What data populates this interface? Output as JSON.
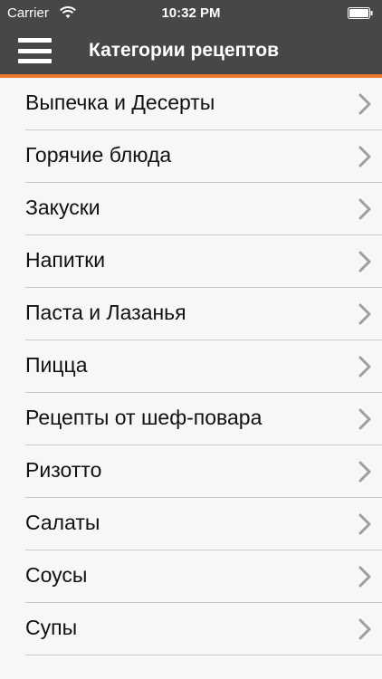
{
  "status_bar": {
    "carrier": "Carrier",
    "time": "10:32 PM",
    "icons": [
      "wifi-icon",
      "battery-icon"
    ]
  },
  "nav": {
    "title": "Категории рецептов",
    "menu_icon": "hamburger-menu-icon"
  },
  "colors": {
    "bar_background": "#474747",
    "accent": "#e8792d",
    "list_background": "#f7f7f7",
    "chevron": "#9e9e9e"
  },
  "categories": [
    {
      "label": "Выпечка и Десерты"
    },
    {
      "label": "Горячие блюда"
    },
    {
      "label": "Закуски"
    },
    {
      "label": "Напитки"
    },
    {
      "label": "Паста и Лазанья"
    },
    {
      "label": "Пицца"
    },
    {
      "label": "Рецепты от шеф-повара"
    },
    {
      "label": "Ризотто"
    },
    {
      "label": "Салаты"
    },
    {
      "label": "Соусы"
    },
    {
      "label": "Супы"
    }
  ]
}
